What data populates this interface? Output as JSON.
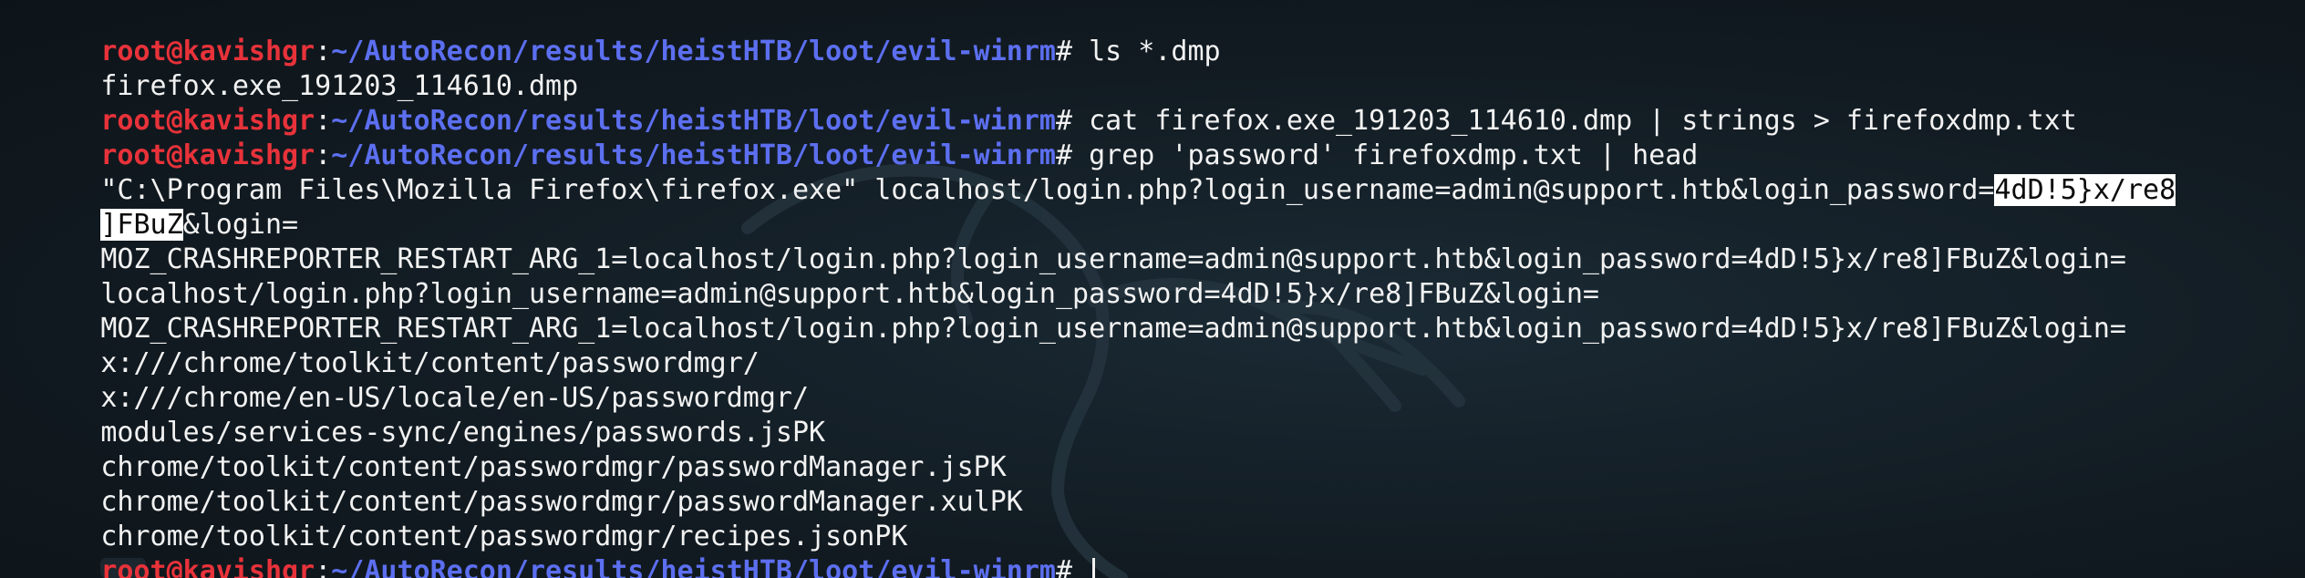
{
  "prompt": {
    "user_host": "root@kavishgr",
    "separator": ":",
    "path": "~/AutoRecon/results/heistHTB/loot/evil-winrm",
    "symbol": "# "
  },
  "lines": {
    "l1": {
      "cmd": "ls *.dmp"
    },
    "l2": {
      "text": "firefox.exe_191203_114610.dmp"
    },
    "l3": {
      "cmd": "cat firefox.exe_191203_114610.dmp | strings > firefoxdmp.txt"
    },
    "l4": {
      "cmd": "grep 'password' firefoxdmp.txt | head"
    },
    "l5": {
      "text": "\"C:\\Program Files\\Mozilla Firefox\\firefox.exe\" localhost/login.php?login_username=admin@support.htb&login_password=",
      "highlight": "4dD!5}x/re8"
    },
    "l6": {
      "highlight": "]FBuZ",
      "text": "&login="
    },
    "l7": {
      "text": "MOZ_CRASHREPORTER_RESTART_ARG_1=localhost/login.php?login_username=admin@support.htb&login_password=4dD!5}x/re8]FBuZ&login="
    },
    "l8": {
      "text": "localhost/login.php?login_username=admin@support.htb&login_password=4dD!5}x/re8]FBuZ&login="
    },
    "l9": {
      "text": "MOZ_CRASHREPORTER_RESTART_ARG_1=localhost/login.php?login_username=admin@support.htb&login_password=4dD!5}x/re8]FBuZ&login="
    },
    "l10": {
      "text": "x:///chrome/toolkit/content/passwordmgr/"
    },
    "l11": {
      "text": "x:///chrome/en-US/locale/en-US/passwordmgr/"
    },
    "l12": {
      "text": "modules/services-sync/engines/passwords.jsPK"
    },
    "l13": {
      "text": "chrome/toolkit/content/passwordmgr/passwordManager.jsPK"
    },
    "l14": {
      "text": "chrome/toolkit/content/passwordmgr/passwordManager.xulPK"
    },
    "l15": {
      "text": "chrome/toolkit/content/passwordmgr/recipes.jsonPK"
    },
    "l16": {
      "cmd": ""
    }
  },
  "colors": {
    "background": "#121b22",
    "prompt_user": "#e8323a",
    "prompt_path": "#5c6ff0",
    "text": "#f2f2f2",
    "highlight_bg": "#ffffff"
  },
  "icons": {
    "background_logo": "kali-dragon-icon"
  }
}
